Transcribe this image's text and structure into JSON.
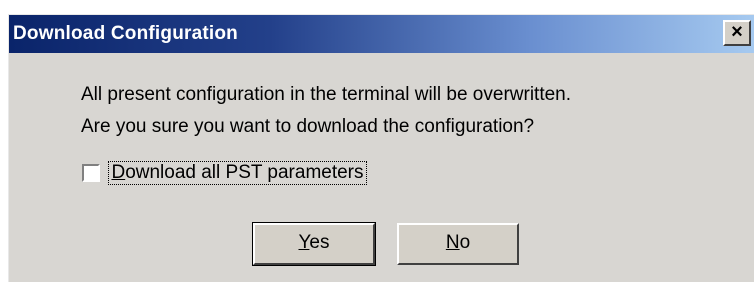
{
  "window": {
    "title": "Download Configuration",
    "close_glyph": "×"
  },
  "message": {
    "line1": "All present configuration in the terminal will be overwritten.",
    "line2": "Are you sure you want to download the configuration?"
  },
  "checkbox": {
    "mnemonic": "D",
    "label_rest": "ownload all PST parameters",
    "checked": false
  },
  "buttons": {
    "yes": {
      "mnemonic": "Y",
      "rest": "es"
    },
    "no": {
      "mnemonic": "N",
      "rest": "o"
    }
  },
  "colors": {
    "titlebar_start": "#0a246a",
    "titlebar_end": "#a6caf0",
    "dialog_bg": "#d8d6d2"
  }
}
